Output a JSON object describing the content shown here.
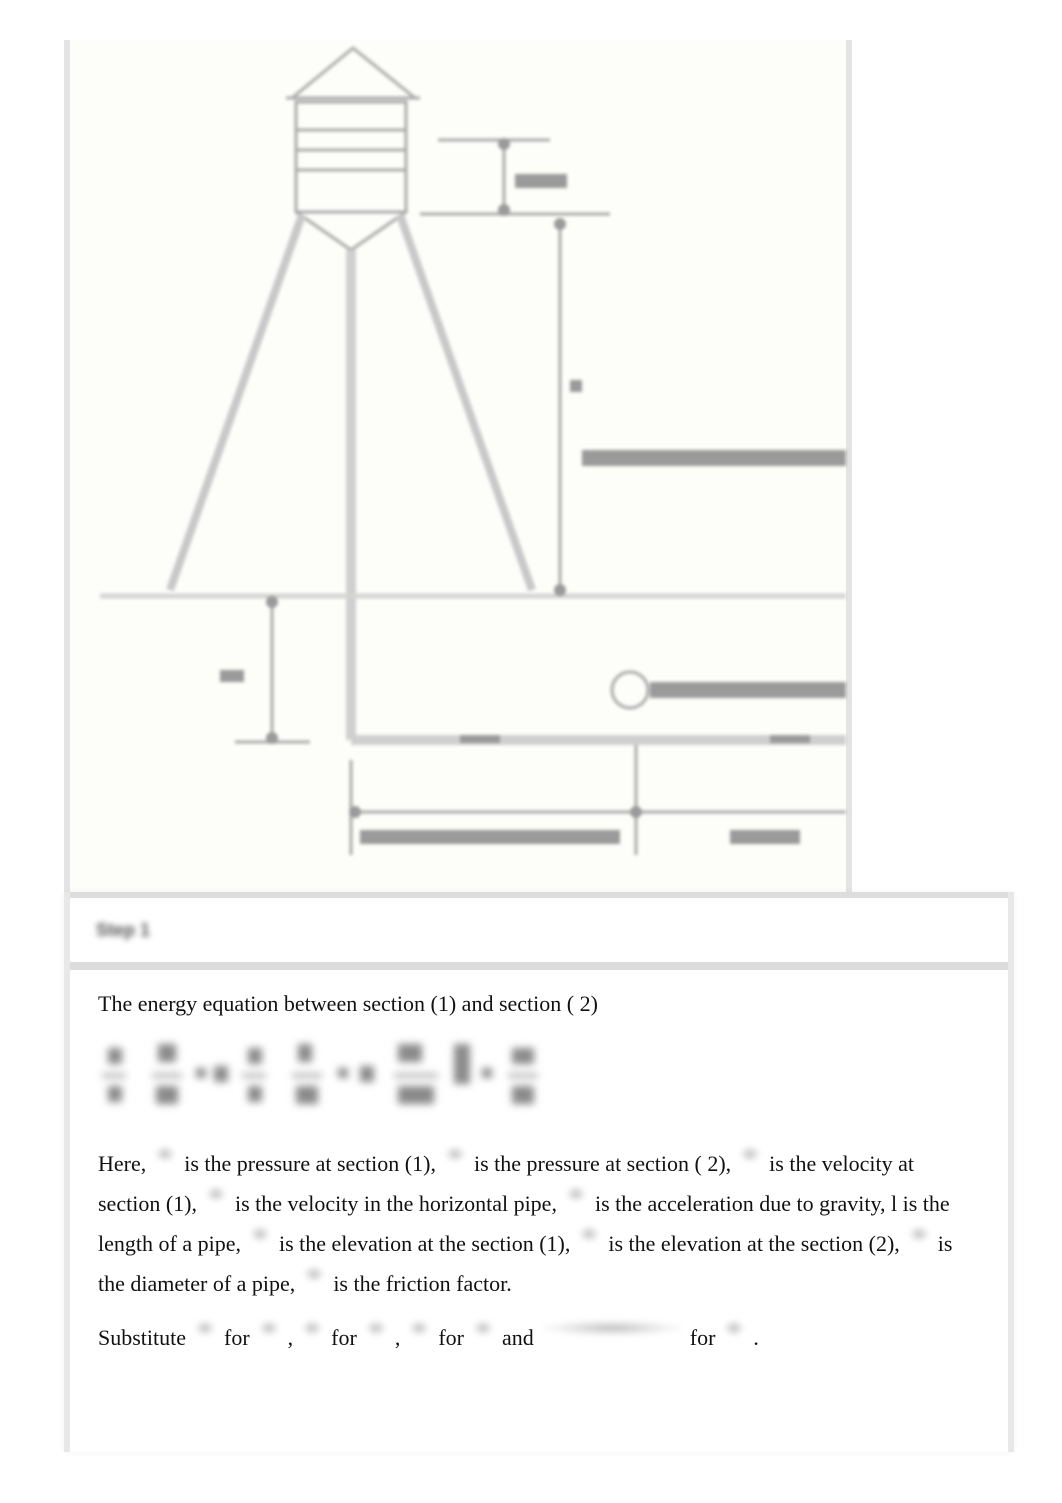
{
  "figure": {
    "description": "Water tower supplying a pipe network (labels illegible)",
    "labels_legible": false
  },
  "step": {
    "title": "Step 1",
    "intro": "The energy equation between section (1) and section ( 2)",
    "here": {
      "t0": "Here,",
      "t1": "is the pressure at section (1),",
      "t2": "is the pressure at section ( 2),",
      "t3": "is the velocity at section (1),",
      "t4": "is the velocity in the horizontal pipe,",
      "t5": "is the acceleration due to gravity, l is the length of a pipe,",
      "t6": "is the elevation at the section (1),",
      "t7": "is the elevation at the section (2),",
      "t8": "is the diameter of a pipe,",
      "t9": "is the friction factor."
    },
    "substitute": {
      "s0": "Substitute",
      "for": "for",
      "comma": ",",
      "and": "and",
      "period": "."
    }
  }
}
